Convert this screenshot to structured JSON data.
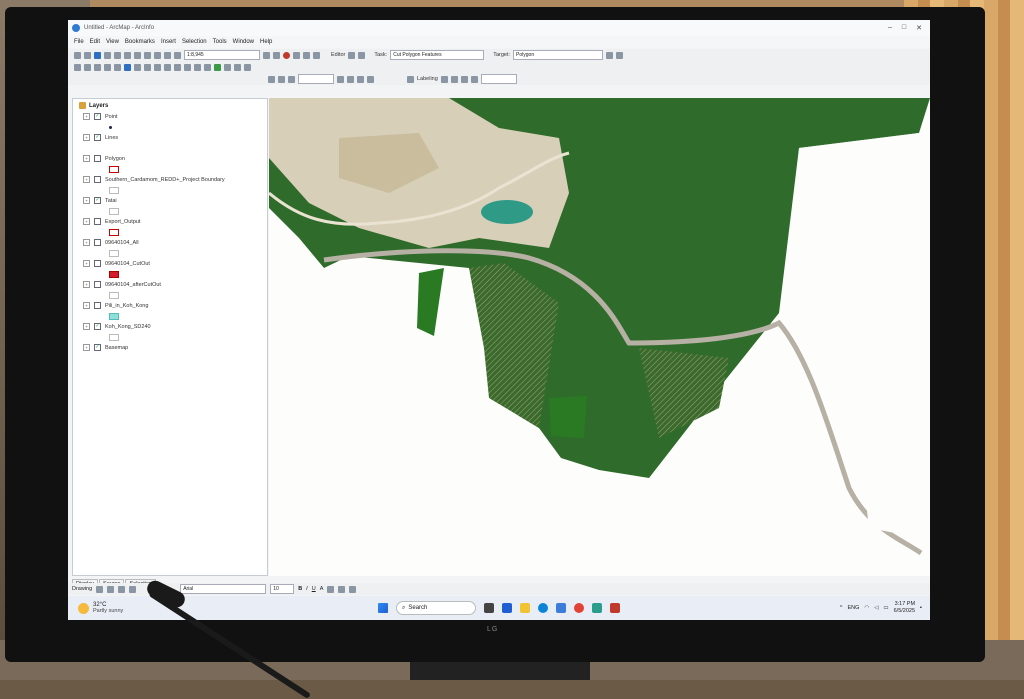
{
  "app": {
    "title": "Untitled - ArcMap - ArcInfo"
  },
  "menu": [
    "File",
    "Edit",
    "View",
    "Bookmarks",
    "Insert",
    "Selection",
    "Tools",
    "Window",
    "Help"
  ],
  "toolbar": {
    "scale": "1:8,945",
    "editor_label": "Editor",
    "task_label": "Task:",
    "task_value": "Cut Polygon Features",
    "target_label": "Target:",
    "target_value": "Polygon",
    "labeling_label": "Labeling"
  },
  "toc": {
    "title": "Layers",
    "layers": [
      {
        "name": "Point",
        "checked": true,
        "symbol": "dot"
      },
      {
        "name": "Lines",
        "checked": true,
        "symbol": "none"
      },
      {
        "name": "Polygon",
        "checked": false,
        "symbol": "red"
      },
      {
        "name": "Southern_Cardamom_REDD+_Project Boundary",
        "checked": false,
        "symbol": "gray"
      },
      {
        "name": "Tatai",
        "checked": true,
        "symbol": "gray"
      },
      {
        "name": "Export_Output",
        "checked": false,
        "symbol": "red"
      },
      {
        "name": "09640104_All",
        "checked": false,
        "symbol": "gray"
      },
      {
        "name": "09640104_CutOut",
        "checked": false,
        "symbol": "fill-red"
      },
      {
        "name": "09640104_afterCutOut",
        "checked": false,
        "symbol": "gray"
      },
      {
        "name": "Pili_in_Koh_Kong",
        "checked": false,
        "symbol": "cyan"
      },
      {
        "name": "Koh_Kong_SD240",
        "checked": true,
        "symbol": "gray"
      },
      {
        "name": "Basemap",
        "checked": true,
        "symbol": "none"
      }
    ],
    "tabs": [
      "Display",
      "Source",
      "Selection"
    ]
  },
  "drawing": {
    "label": "Drawing",
    "font": "Arial",
    "size": "10"
  },
  "taskbar": {
    "temp": "32°C",
    "condition": "Partly sunny",
    "search_placeholder": "Search",
    "language": "ENG",
    "time": "3:17 PM",
    "date": "6/5/2025"
  },
  "brand": "LG",
  "colors": {
    "forest": "#2f6b2a",
    "clearing": "#d8cfb8",
    "road": "#b7b0a4",
    "water": "#2f9a86",
    "mask": "#fdfefc"
  }
}
